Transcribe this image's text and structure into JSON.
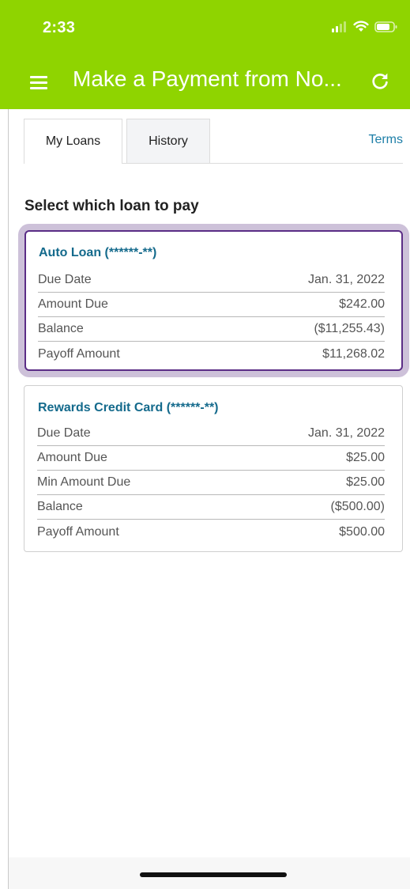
{
  "status_bar": {
    "time": "2:33"
  },
  "header": {
    "title": "Make a Payment from No..."
  },
  "tabs": [
    {
      "label": "My Loans",
      "active": true
    },
    {
      "label": "History",
      "active": false
    }
  ],
  "terms_link": "Terms",
  "section_title": "Select which loan to pay",
  "loans": [
    {
      "title": "Auto Loan (******-**)",
      "selected": true,
      "rows": [
        {
          "label": "Due Date",
          "value": "Jan. 31, 2022"
        },
        {
          "label": "Amount Due",
          "value": "$242.00"
        },
        {
          "label": "Balance",
          "value": "($11,255.43)"
        },
        {
          "label": "Payoff Amount",
          "value": "$11,268.02"
        }
      ]
    },
    {
      "title": "Rewards Credit Card (******-**)",
      "selected": false,
      "rows": [
        {
          "label": "Due Date",
          "value": "Jan. 31, 2022"
        },
        {
          "label": "Amount Due",
          "value": "$25.00"
        },
        {
          "label": "Min Amount Due",
          "value": "$25.00"
        },
        {
          "label": "Balance",
          "value": "($500.00)"
        },
        {
          "label": "Payoff Amount",
          "value": "$500.00"
        }
      ]
    }
  ],
  "colors": {
    "header_green": "#8fd400",
    "link_blue": "#1e7fa8",
    "loan_title": "#146a8c",
    "selected_border": "#5b2d86"
  },
  "icons": [
    "signal-icon",
    "wifi-icon",
    "battery-icon",
    "menu-icon",
    "refresh-icon"
  ]
}
